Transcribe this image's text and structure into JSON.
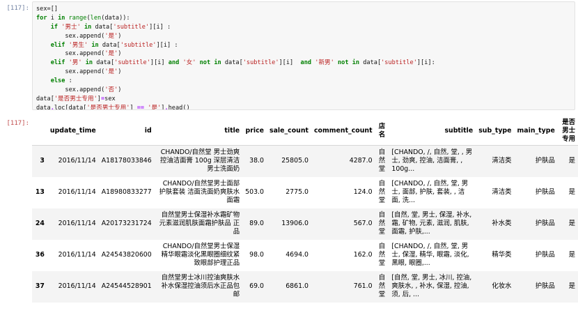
{
  "code_cell": {
    "prompt": "[117]:",
    "lines": [
      [
        {
          "t": "sex=[]"
        }
      ],
      [
        {
          "t": "for",
          "c": "kw"
        },
        {
          "t": " i "
        },
        {
          "t": "in",
          "c": "kw"
        },
        {
          "t": " "
        },
        {
          "t": "range",
          "c": "bi"
        },
        {
          "t": "("
        },
        {
          "t": "len",
          "c": "bi"
        },
        {
          "t": "(data)):"
        }
      ],
      [
        {
          "t": "    "
        },
        {
          "t": "if",
          "c": "kw"
        },
        {
          "t": " "
        },
        {
          "t": "'男士'",
          "c": "str"
        },
        {
          "t": " "
        },
        {
          "t": "in",
          "c": "kw"
        },
        {
          "t": " data["
        },
        {
          "t": "'subtitle'",
          "c": "str"
        },
        {
          "t": "][i] :"
        }
      ],
      [
        {
          "t": "        sex.append("
        },
        {
          "t": "'是'",
          "c": "str"
        },
        {
          "t": ")"
        }
      ],
      [
        {
          "t": "    "
        },
        {
          "t": "elif",
          "c": "kw"
        },
        {
          "t": " "
        },
        {
          "t": "'男生'",
          "c": "str"
        },
        {
          "t": " "
        },
        {
          "t": "in",
          "c": "kw"
        },
        {
          "t": " data["
        },
        {
          "t": "'subtitle'",
          "c": "str"
        },
        {
          "t": "][i] :"
        }
      ],
      [
        {
          "t": "        sex.append("
        },
        {
          "t": "'是'",
          "c": "str"
        },
        {
          "t": ")"
        }
      ],
      [
        {
          "t": "    "
        },
        {
          "t": "elif",
          "c": "kw"
        },
        {
          "t": " "
        },
        {
          "t": "'男'",
          "c": "str"
        },
        {
          "t": " "
        },
        {
          "t": "in",
          "c": "kw"
        },
        {
          "t": " data["
        },
        {
          "t": "'subtitle'",
          "c": "str"
        },
        {
          "t": "][i] "
        },
        {
          "t": "and",
          "c": "kw"
        },
        {
          "t": " "
        },
        {
          "t": "'女'",
          "c": "str"
        },
        {
          "t": " "
        },
        {
          "t": "not",
          "c": "kw"
        },
        {
          "t": " "
        },
        {
          "t": "in",
          "c": "kw"
        },
        {
          "t": " data["
        },
        {
          "t": "'subtitle'",
          "c": "str"
        },
        {
          "t": "][i]  "
        },
        {
          "t": "and",
          "c": "kw"
        },
        {
          "t": " "
        },
        {
          "t": "'新男'",
          "c": "str"
        },
        {
          "t": " "
        },
        {
          "t": "not",
          "c": "kw"
        },
        {
          "t": " "
        },
        {
          "t": "in",
          "c": "kw"
        },
        {
          "t": " data["
        },
        {
          "t": "'subtitle'",
          "c": "str"
        },
        {
          "t": "][i]:"
        }
      ],
      [
        {
          "t": "        sex.append("
        },
        {
          "t": "'是'",
          "c": "str"
        },
        {
          "t": ")"
        }
      ],
      [
        {
          "t": "    "
        },
        {
          "t": "else",
          "c": "kw"
        },
        {
          "t": " :"
        }
      ],
      [
        {
          "t": "        sex.append("
        },
        {
          "t": "'否'",
          "c": "str"
        },
        {
          "t": ")"
        }
      ],
      [
        {
          "t": "data["
        },
        {
          "t": "'是否男士专用'",
          "c": "str"
        },
        {
          "t": "]"
        },
        {
          "t": "=",
          "c": "op"
        },
        {
          "t": "sex"
        }
      ],
      [
        {
          "t": "data"
        },
        {
          "t": ".",
          "c": "op"
        },
        {
          "t": "loc[data["
        },
        {
          "t": "'是否男士专用'",
          "c": "str"
        },
        {
          "t": "] "
        },
        {
          "t": "==",
          "c": "op"
        },
        {
          "t": " "
        },
        {
          "t": "'是'",
          "c": "str"
        },
        {
          "t": "]"
        },
        {
          "t": ".",
          "c": "op"
        },
        {
          "t": "head()"
        }
      ]
    ]
  },
  "output_cell": {
    "prompt": "[117]:",
    "columns": [
      "update_time",
      "id",
      "title",
      "price",
      "sale_count",
      "comment_count",
      "店名",
      "subtitle",
      "sub_type",
      "main_type",
      "是否男士专用"
    ],
    "rows": [
      {
        "index": "3",
        "update_time": "2016/11/14",
        "id": "A18178033846",
        "title": "CHANDO/自然堂 男士劲爽控油洁面膏 100g 深层清洁 男士洗面奶",
        "price": "38.0",
        "sale_count": "25805.0",
        "comment_count": "4287.0",
        "shop": "自然堂",
        "subtitle": "[CHANDO, /, 自然, 堂, , 男士, 劲爽, 控油, 洁面膏, , 100g...",
        "sub_type": "清洁类",
        "main_type": "护肤品",
        "male": "是"
      },
      {
        "index": "13",
        "update_time": "2016/11/14",
        "id": "A18980833277",
        "title": "CHANDO/自然堂男士面部护肤套装 洁面洗面奶爽肤水面霜",
        "price": "503.0",
        "sale_count": "2775.0",
        "comment_count": "124.0",
        "shop": "自然堂",
        "subtitle": "[CHANDO, /, 自然, 堂, 男士, 面部, 护肤, 套装, , 洁面, 洗...",
        "sub_type": "清洁类",
        "main_type": "护肤品",
        "male": "是"
      },
      {
        "index": "24",
        "update_time": "2016/11/14",
        "id": "A20173231724",
        "title": "自然堂男士保湿补水霜矿物元素滋润肌肤面霜护肤品 正品",
        "price": "89.0",
        "sale_count": "13906.0",
        "comment_count": "567.0",
        "shop": "自然堂",
        "subtitle": "[自然, 堂, 男士, 保湿, 补水, 霜, 矿物, 元素, 滋润, 肌肤, 面霜, 护肤,...",
        "sub_type": "补水类",
        "main_type": "护肤品",
        "male": "是"
      },
      {
        "index": "36",
        "update_time": "2016/11/14",
        "id": "A24543820600",
        "title": "CHANDO/自然堂男士保湿精华眼霜淡化黑眼圈细纹紧致眼部护理正品",
        "price": "98.0",
        "sale_count": "4694.0",
        "comment_count": "162.0",
        "shop": "自然堂",
        "subtitle": "[CHANDO, /, 自然, 堂, 男士, 保湿, 精华, 眼霜, 淡化, 黑眼, 眼圈,...",
        "sub_type": "精华类",
        "main_type": "护肤品",
        "male": "是"
      },
      {
        "index": "37",
        "update_time": "2016/11/14",
        "id": "A24544528901",
        "title": "自然堂男士冰川控油爽肤水 补水保湿控油须后水正品包邮",
        "price": "69.0",
        "sale_count": "6861.0",
        "comment_count": "761.0",
        "shop": "自然堂",
        "subtitle": "[自然, 堂, 男士, 冰川, 控油, 爽肤水, , 补水, 保湿, 控油, 须, 后, ...",
        "sub_type": "化妆水",
        "main_type": "护肤品",
        "male": "是"
      }
    ]
  }
}
